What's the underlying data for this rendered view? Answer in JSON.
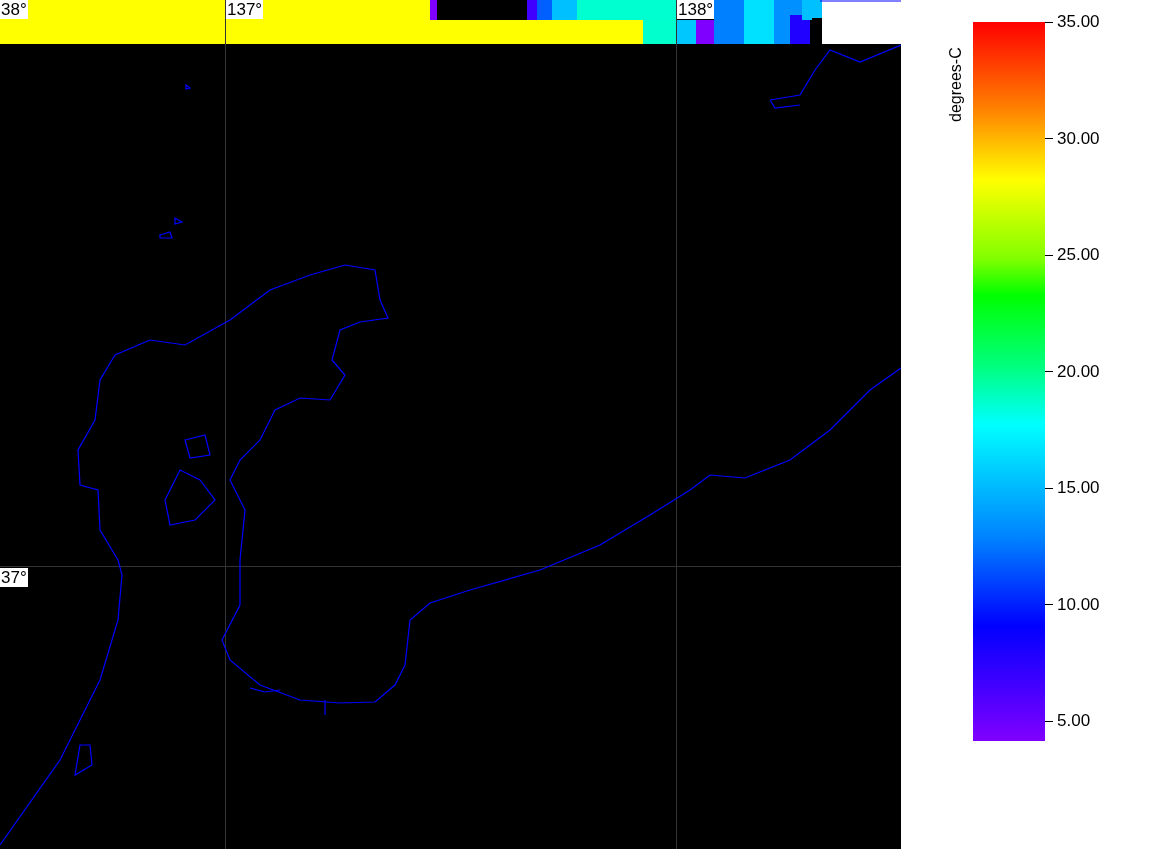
{
  "map": {
    "grid_labels": [
      {
        "text": "38°"
      },
      {
        "text": "137°"
      },
      {
        "text": "138°"
      },
      {
        "text": "37°"
      }
    ]
  },
  "colorbar": {
    "title": "degrees-C",
    "ticks": [
      "35.00",
      "30.00",
      "25.00",
      "20.00",
      "15.00",
      "10.00",
      "5.00"
    ]
  }
}
